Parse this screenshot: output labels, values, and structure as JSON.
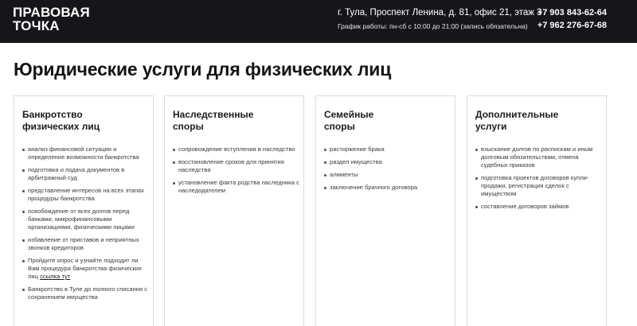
{
  "header": {
    "logo_line1": "ПРАВОВАЯ",
    "logo_line2": "ТОЧКА",
    "address": "г. Тула, Проспект Ленина, д. 81, офис 21, этаж 3",
    "hours": "График работы: пн-сб с 10:00 до 21:00 (запись обязательна)",
    "phone1": "+7 903 843-62-64",
    "phone2": "+7 962 276-67-68"
  },
  "page_title": "Юридические услуги для физических лиц",
  "cards": [
    {
      "title_line1": "Банкротство",
      "title_line2": "физических лиц",
      "items": [
        "анализ финансовой ситуации и определение возможности банкротства",
        "подготовка и подача документов в арбитражный суд",
        "представление интересов на всех этапах процедуры банкротства",
        "освобождение от всех долгов перед банками, микрофинансовыми организациями, физическими лицами",
        "избавление от приставов и неприятных звонков кредиторов",
        "Пройдите опрос и узнайте подходит ли Вам процедура банкротства физических лиц",
        "Банкротство в Туле до полного списания с сохранением имущества"
      ],
      "link_text": "ссылка тут"
    },
    {
      "title_line1": "Наследственные",
      "title_line2": "споры",
      "items": [
        "сопровождение вступления в наследство",
        "восстановление сроков для принятия наследства",
        "установление факта родства наследника с наследодателем"
      ]
    },
    {
      "title_line1": "Семейные",
      "title_line2": "споры",
      "items": [
        "расторжение брака",
        "раздел имущества",
        "алименты",
        "заключение брачного договора"
      ]
    },
    {
      "title_line1": "Дополнительные",
      "title_line2": "услуги",
      "items": [
        "взыскание долгов по распискам и иным долговым обязательствам, отмена судебных приказов",
        "подготовка проектов договоров купли-продажи, регистрация сделок с имуществом",
        "составление договоров займов"
      ]
    }
  ]
}
